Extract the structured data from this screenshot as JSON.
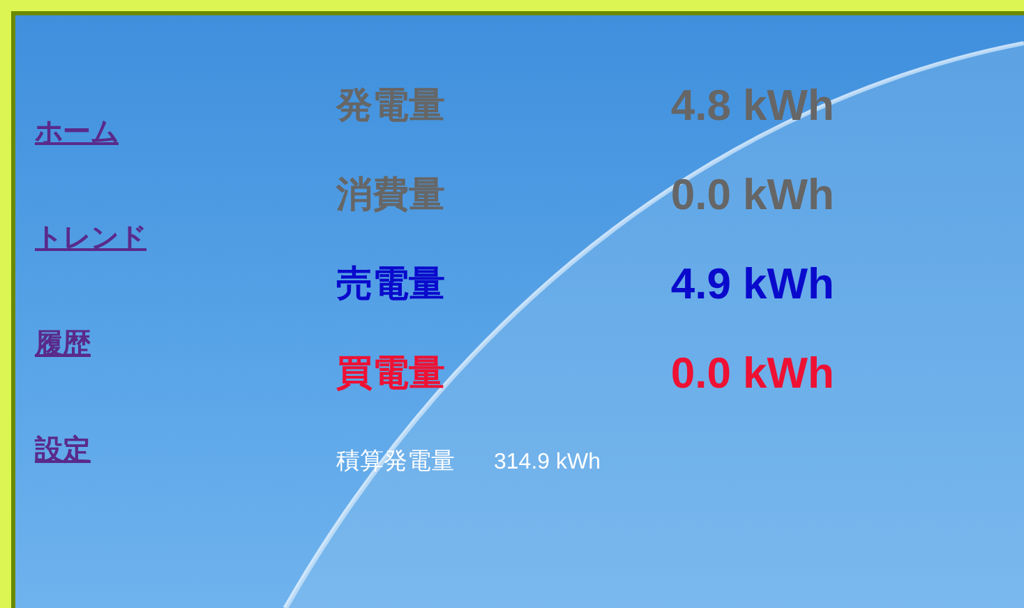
{
  "nav": [
    {
      "label": "ホーム"
    },
    {
      "label": "トレンド"
    },
    {
      "label": "履歴"
    },
    {
      "label": "設定"
    }
  ],
  "metrics": [
    {
      "label": "発電量",
      "value": "4.8 kWh",
      "color": "#666666"
    },
    {
      "label": "消費量",
      "value": "0.0 kWh",
      "color": "#666666"
    },
    {
      "label": "売電量",
      "value": "4.9 kWh",
      "color": "#0a0acc"
    },
    {
      "label": "買電量",
      "value": "0.0 kWh",
      "color": "#ee1133"
    }
  ],
  "total": {
    "label": "積算発電量",
    "value": "314.9 kWh"
  }
}
